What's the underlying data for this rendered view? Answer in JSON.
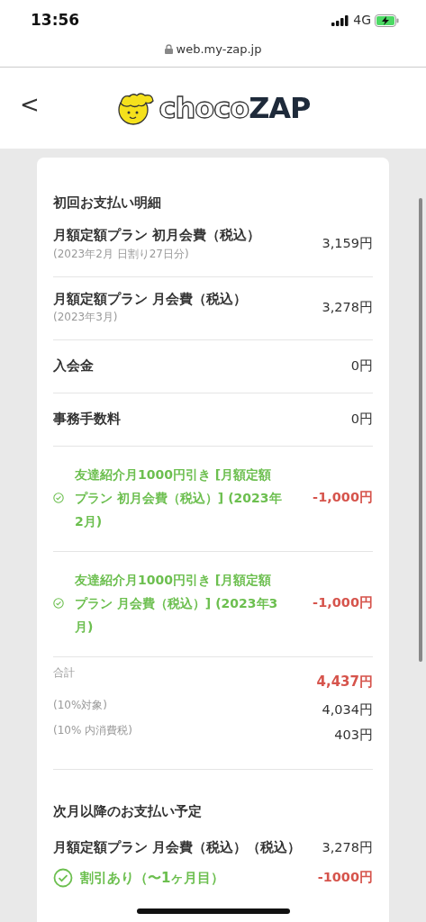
{
  "status_bar": {
    "time": "13:56",
    "network": "4G"
  },
  "address_bar": {
    "url": "web.my-zap.jp"
  },
  "header": {
    "back": "<",
    "logo": {
      "light": "choco",
      "bold": "ZAP"
    }
  },
  "first_payment": {
    "title": "初回お支払い明細",
    "rows": [
      {
        "kind": "item",
        "label": "月額定額プラン 初月会費（税込）",
        "note": "(2023年2月 日割り27日分)",
        "amount": "3,159円"
      },
      {
        "kind": "item",
        "label": "月額定額プラン 月会費（税込）",
        "note": "(2023年3月)",
        "amount": "3,278円"
      },
      {
        "kind": "item",
        "label": "入会金",
        "amount": "0円"
      },
      {
        "kind": "item",
        "label": "事務手数料",
        "amount": "0円"
      },
      {
        "kind": "discount",
        "label": "友達紹介月1000円引き [月額定額プラン 初月会費（税込）] (2023年2月)",
        "amount": "-1,000円"
      },
      {
        "kind": "discount",
        "label": "友達紹介月1000円引き [月額定額プラン 月会費（税込）] (2023年3月)",
        "amount": "-1,000円"
      }
    ],
    "totals": [
      {
        "kind": "total",
        "label": "合計",
        "amount": "4,437円"
      },
      {
        "kind": "sub",
        "label": "(10%対象)",
        "amount": "4,034円"
      },
      {
        "kind": "sub",
        "label": "(10% 内消費税)",
        "amount": "403円"
      }
    ]
  },
  "next_payment": {
    "title": "次月以降のお支払い予定",
    "rows": [
      {
        "kind": "item",
        "label": "月額定額プラン 月会費（税込）（税込）",
        "amount": "3,278円"
      },
      {
        "kind": "discount",
        "label": "割引あり（〜1ヶ月目）",
        "amount": "-1000円"
      }
    ]
  }
}
